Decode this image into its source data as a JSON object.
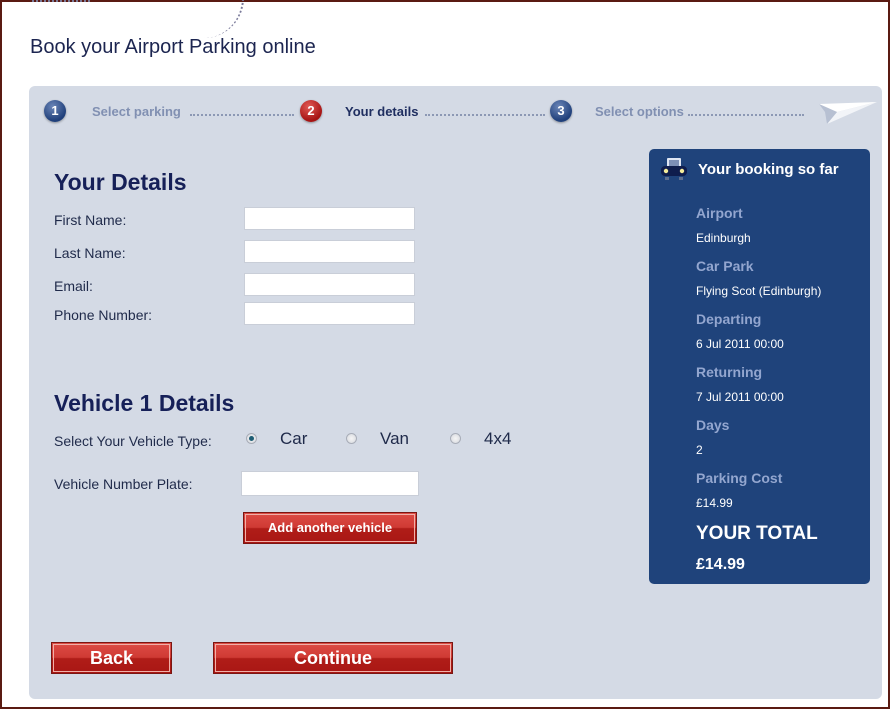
{
  "page": {
    "title": "Book your Airport Parking online"
  },
  "steps": [
    {
      "number": "1",
      "label": "Select parking",
      "state": "done"
    },
    {
      "number": "2",
      "label": "Your details",
      "state": "active"
    },
    {
      "number": "3",
      "label": "Select options",
      "state": "pending"
    }
  ],
  "your_details": {
    "heading": "Your Details",
    "fields": [
      {
        "label": "First Name:",
        "value": "",
        "placeholder": ""
      },
      {
        "label": "Last Name:",
        "value": "",
        "placeholder": ""
      },
      {
        "label": "Email:",
        "value": "",
        "placeholder": ""
      },
      {
        "label": "Phone Number:",
        "value": "",
        "placeholder": ""
      }
    ]
  },
  "vehicle": {
    "heading": "Vehicle 1 Details",
    "type_label": "Select Your Vehicle Type:",
    "types": [
      {
        "label": "Car",
        "checked": true
      },
      {
        "label": "Van",
        "checked": false
      },
      {
        "label": "4x4",
        "checked": false
      }
    ],
    "plate_label": "Vehicle Number Plate:",
    "plate_value": "",
    "add_button": "Add another vehicle"
  },
  "buttons": {
    "back": "Back",
    "continue": "Continue"
  },
  "summary": {
    "title": "Your booking so far",
    "icon": "car-icon",
    "items": [
      {
        "key": "Airport",
        "value": "Edinburgh"
      },
      {
        "key": "Car Park",
        "value": "Flying Scot (Edinburgh)"
      },
      {
        "key": "Departing",
        "value": "6 Jul 2011 00:00"
      },
      {
        "key": "Returning",
        "value": "7 Jul 2011 00:00"
      },
      {
        "key": "Days",
        "value": "2"
      },
      {
        "key": "Parking Cost",
        "value": "£14.99"
      }
    ],
    "total_label": "YOUR TOTAL",
    "total_value": "£14.99"
  },
  "colors": {
    "brand_blue": "#1f437b",
    "button_red": "#c0302a",
    "panel_bg": "#d4dae5",
    "heading_navy": "#162058"
  }
}
